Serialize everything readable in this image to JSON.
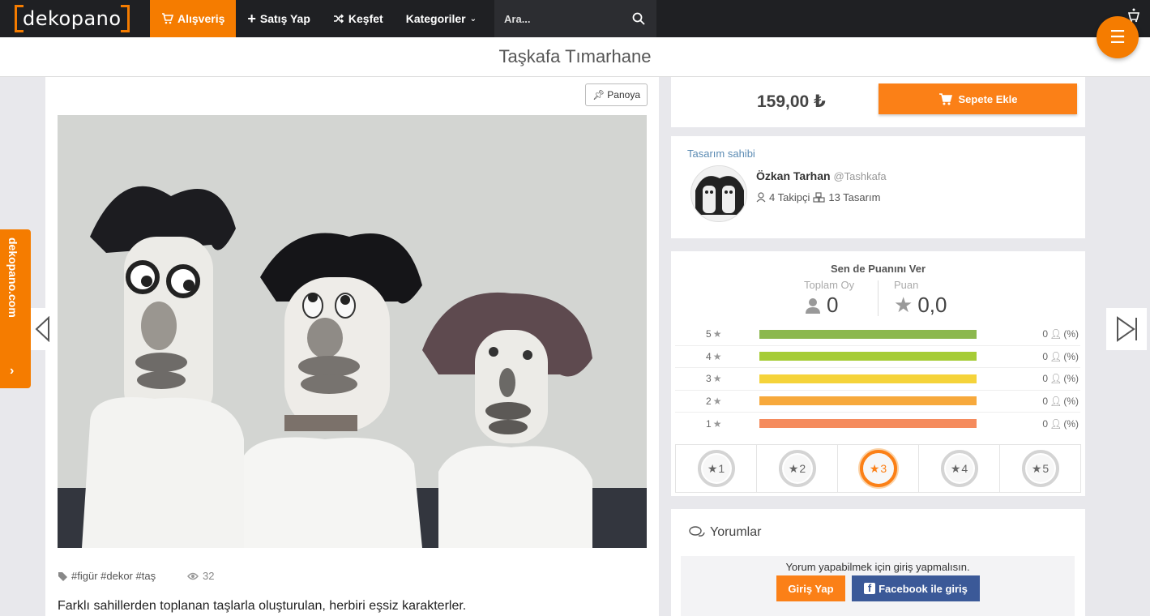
{
  "nav": {
    "logo": "dekopano",
    "items": [
      {
        "label": "Alışveriş",
        "icon": "cart-icon"
      },
      {
        "label": "Satış Yap",
        "icon": "plus-icon"
      },
      {
        "label": "Keşfet",
        "icon": "shuffle-icon"
      },
      {
        "label": "Kategoriler",
        "icon": "chevron-down-icon"
      }
    ],
    "search_placeholder": "Ara..."
  },
  "page": {
    "title": "Taşkafa Tımarhane"
  },
  "product": {
    "pin_label": "Panoya",
    "tags": "#figür #dekor #taş",
    "views": "32",
    "description": "Farklı sahillerden toplanan taşlarla oluşturulan, herbiri eşsiz karakterler."
  },
  "sidebar": {
    "brand": "dekopano.com",
    "chevron": "›"
  },
  "purchase": {
    "price": "159,00 ₺",
    "add_to_cart": "Sepete Ekle"
  },
  "owner": {
    "section_label": "Tasarım sahibi",
    "name": "Özkan Tarhan",
    "handle": "@Tashkafa",
    "followers": "4 Takipçi",
    "designs": "13 Tasarım"
  },
  "rating": {
    "title": "Sen de Puanını Ver",
    "total_votes_label": "Toplam Oy",
    "total_votes": "0",
    "score_label": "Puan",
    "score": "0,0",
    "rows": [
      {
        "stars": "5",
        "count": "0",
        "pct": "(%)",
        "color": "#8cb84e"
      },
      {
        "stars": "4",
        "count": "0",
        "pct": "(%)",
        "color": "#a6cc36"
      },
      {
        "stars": "3",
        "count": "0",
        "pct": "(%)",
        "color": "#f5d33a"
      },
      {
        "stars": "2",
        "count": "0",
        "pct": "(%)",
        "color": "#f7a93c"
      },
      {
        "stars": "1",
        "count": "0",
        "pct": "(%)",
        "color": "#f58b5d"
      }
    ],
    "buttons": [
      "1",
      "2",
      "3",
      "4",
      "5"
    ],
    "active_button": "3"
  },
  "comments": {
    "title": "Yorumlar",
    "login_message": "Yorum yapabilmek için giriş yapmalısın.",
    "login_button": "Giriş Yap",
    "facebook_button": "Facebook ile giriş"
  }
}
